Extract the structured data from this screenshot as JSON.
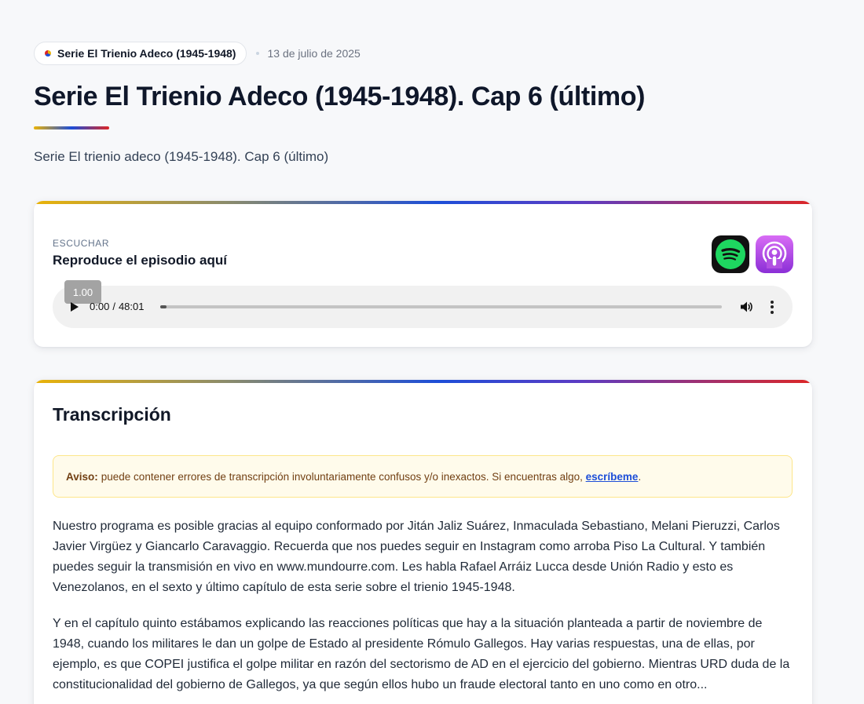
{
  "header": {
    "series_pill": "Serie El Trienio Adeco (1945-1948)",
    "date": "13 de julio de 2025",
    "title": "Serie El Trienio Adeco (1945-1948). Cap 6 (último)",
    "subtitle": "Serie El trienio adeco (1945-1948). Cap 6 (último)"
  },
  "colors": {
    "accent_yellow": "#eab308",
    "accent_blue": "#1d4ed8",
    "accent_red": "#dc2626",
    "spotify_green": "#1ed760",
    "podcasts_purple": "#b150e2"
  },
  "player_card": {
    "label": "ESCUCHAR",
    "title": "Reproduce el episodio aquí",
    "platforms": [
      {
        "name": "spotify-icon"
      },
      {
        "name": "apple-podcasts-icon"
      }
    ],
    "audio": {
      "speed": "1.00",
      "current_time": "0:00",
      "separator": "/",
      "duration": "48:01",
      "progress": 0.0
    }
  },
  "transcript": {
    "title": "Transcripción",
    "notice": {
      "label": "Aviso:",
      "text": "puede contener errores de transcripción involuntariamente confusos y/o inexactos. Si encuentras algo,",
      "link": "escríbeme",
      "end": "."
    },
    "paragraphs": [
      "Nuestro programa es posible gracias al equipo conformado por Jitán Jaliz Suárez, Inmaculada Sebastiano, Melani Pieruzzi, Carlos Javier Virgüez y Giancarlo Caravaggio. Recuerda que nos puedes seguir en Instagram como arroba Piso La Cultural. Y también puedes seguir la transmisión en vivo en www.mundourre.com. Les habla Rafael Arráiz Lucca desde Unión Radio y esto es Venezolanos, en el sexto y último capítulo de esta serie sobre el trienio 1945-1948.",
      "Y en el capítulo quinto estábamos explicando las reacciones políticas que hay a la situación planteada a partir de noviembre de 1948, cuando los militares le dan un golpe de Estado al presidente Rómulo Gallegos. Hay varias respuestas, una de ellas, por ejemplo, es que COPEI justifica el golpe militar en razón del sectorismo de AD en el ejercicio del gobierno. Mientras URD duda de la constitucionalidad del gobierno de Gallegos, ya que según ellos hubo un fraude electoral tanto en uno como en otro..."
    ]
  }
}
